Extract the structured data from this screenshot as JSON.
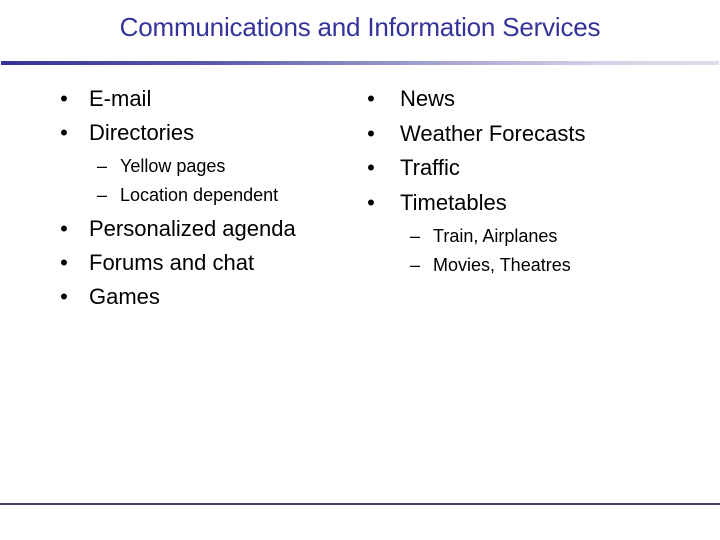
{
  "slide": {
    "title": "Communications and Information Services",
    "accent_color": "#333399",
    "bullet_glyph": "•",
    "dash_glyph": "–",
    "left_column": {
      "items": [
        {
          "label": "E-mail",
          "subitems": []
        },
        {
          "label": "Directories",
          "subitems": [
            "Yellow pages",
            "Location dependent"
          ]
        },
        {
          "label": "Personalized agenda",
          "subitems": []
        },
        {
          "label": "Forums and chat",
          "subitems": []
        },
        {
          "label": "Games",
          "subitems": []
        }
      ]
    },
    "right_column": {
      "items": [
        {
          "label": "News",
          "subitems": []
        },
        {
          "label": "Weather Forecasts",
          "subitems": []
        },
        {
          "label": "Traffic",
          "subitems": []
        },
        {
          "label": "Timetables",
          "subitems": [
            "Train, Airplanes",
            "Movies, Theatres"
          ]
        }
      ]
    }
  }
}
